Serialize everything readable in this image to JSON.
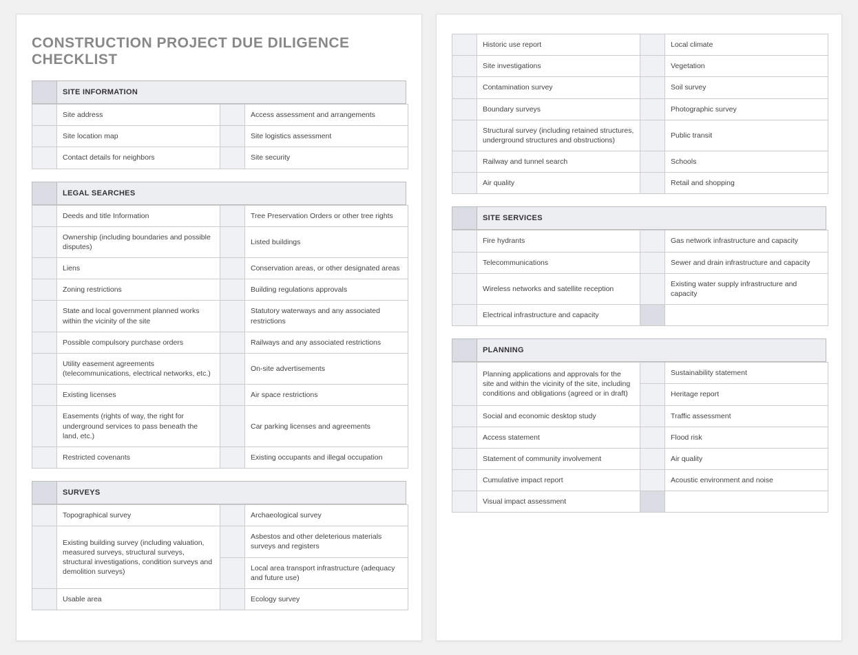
{
  "title": "CONSTRUCTION PROJECT DUE DILIGENCE CHECKLIST",
  "chart_data": {
    "type": "table",
    "title": "Construction Project Due Diligence Checklist",
    "sections": [
      {
        "header": "SITE INFORMATION",
        "left": [
          "Site address",
          "Site location map",
          "Contact details for neighbors"
        ],
        "right": [
          "Access assessment and arrangements",
          "Site logistics assessment",
          "Site security"
        ]
      },
      {
        "header": "LEGAL SEARCHES",
        "left": [
          "Deeds and title Information",
          "Ownership (including boundaries and possible disputes)",
          "Liens",
          "Zoning restrictions",
          "State and local government planned works within the vicinity of the site",
          "Possible compulsory purchase orders",
          "Utility easement agreements (telecommunications, electrical networks, etc.)",
          "Existing licenses",
          "Easements (rights of way, the right for underground services to pass beneath the land, etc.)",
          "Restricted covenants"
        ],
        "right": [
          "Tree Preservation Orders or other tree rights",
          "Listed buildings",
          "Conservation areas, or other designated areas",
          "Building regulations approvals",
          "Statutory waterways and any associated restrictions",
          "Railways and any associated restrictions",
          "On-site advertisements",
          "Air space restrictions",
          "Car parking licenses and agreements",
          "Existing occupants and illegal occupation"
        ]
      },
      {
        "header": "SURVEYS",
        "left": [
          "Topographical survey",
          "Existing building survey (including valuation, measured surveys, structural surveys, structural investigations, condition surveys and demolition surveys)",
          "Usable area",
          "Historic use report",
          "Site investigations",
          "Contamination survey",
          "Boundary surveys",
          "Structural survey (including retained structures, underground structures and obstructions)",
          "Railway and tunnel search",
          "Air quality"
        ],
        "right": [
          "Archaeological survey",
          "Asbestos and other deleterious materials surveys and registers",
          "Local area transport infrastructure (adequacy and future use)",
          "Ecology survey",
          "Local climate",
          "Vegetation",
          "Soil survey",
          "Photographic survey",
          "Public transit",
          "Schools",
          "Retail and shopping"
        ]
      },
      {
        "header": "SITE SERVICES",
        "left": [
          "Fire hydrants",
          "Telecommunications",
          "Wireless networks and satellite reception",
          "Electrical infrastructure and capacity"
        ],
        "right": [
          "Gas network infrastructure and capacity",
          "Sewer and drain infrastructure and capacity",
          "Existing water supply infrastructure and capacity",
          ""
        ]
      },
      {
        "header": "PLANNING",
        "left": [
          "Planning applications and approvals for the site and within the vicinity of the site, including conditions and obligations (agreed or in draft)",
          "Social and economic desktop study",
          "Access statement",
          "Statement of community involvement",
          "Cumulative impact report",
          "Visual impact assessment"
        ],
        "right": [
          "Sustainability statement",
          "Heritage report",
          "Traffic assessment",
          "Flood risk",
          "Air quality",
          "Acoustic environment and noise",
          ""
        ]
      }
    ]
  }
}
